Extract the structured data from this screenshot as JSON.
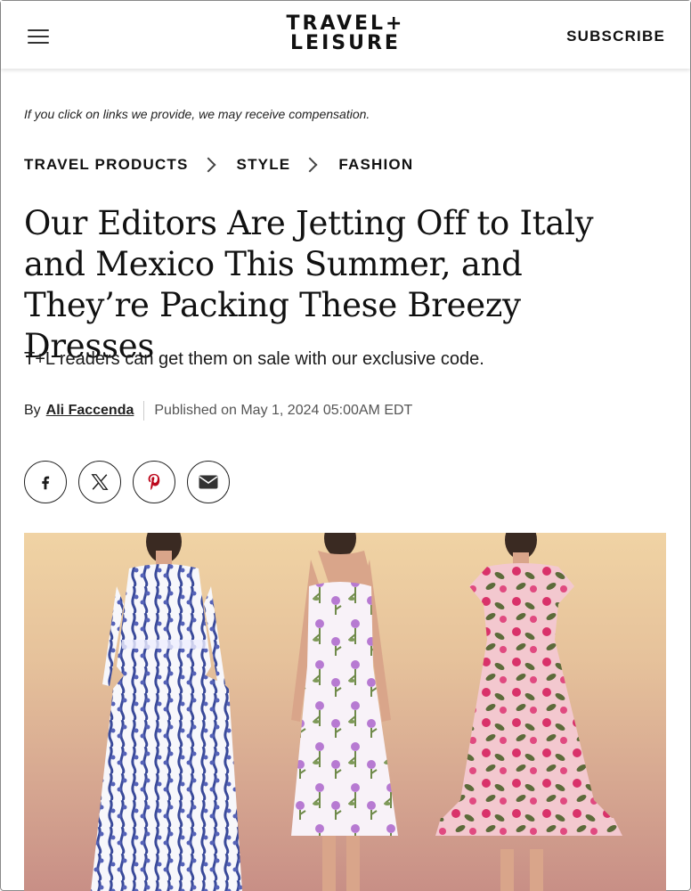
{
  "header": {
    "logo_line1": "TRAVEL+",
    "logo_line2": "LEISURE",
    "subscribe_label": "SUBSCRIBE"
  },
  "disclaimer": "If you click on links we provide, we may receive compensation.",
  "breadcrumb": [
    "TRAVEL PRODUCTS",
    "STYLE",
    "FASHION"
  ],
  "article": {
    "title": "Our Editors Are Jetting Off to Italy and Mexico This Summer, and They’re Packing These Breezy Dresses",
    "dek": "T+L readers can get them on sale with our exclusive code.",
    "by_label": "By",
    "author": "Ali Faccenda",
    "published": "Published on May 1, 2024 05:00AM EDT"
  },
  "share_icons": [
    "facebook-icon",
    "x-icon",
    "pinterest-icon",
    "email-icon"
  ],
  "colors": {
    "pinterest": "#bd081c",
    "facebook": "#1a1a1a",
    "hero_top": "#f0d3a4",
    "hero_bottom": "#c88f86"
  }
}
